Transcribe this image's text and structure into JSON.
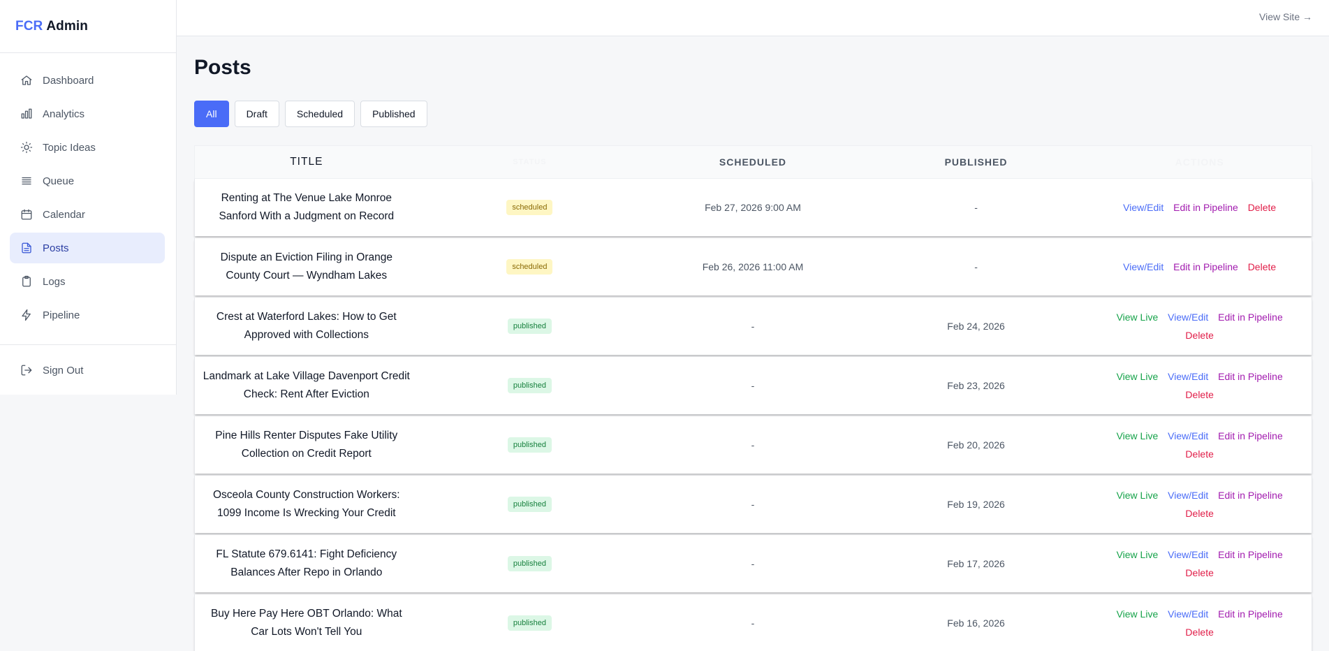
{
  "brand": {
    "accent": "FCR",
    "name": "Admin"
  },
  "sidebar": {
    "items": [
      {
        "label": "Dashboard",
        "icon": "home-icon"
      },
      {
        "label": "Analytics",
        "icon": "bar-chart-icon"
      },
      {
        "label": "Topic Ideas",
        "icon": "lightbulb-icon"
      },
      {
        "label": "Queue",
        "icon": "list-icon"
      },
      {
        "label": "Calendar",
        "icon": "calendar-icon"
      },
      {
        "label": "Posts",
        "icon": "document-icon",
        "active": true
      },
      {
        "label": "Logs",
        "icon": "clipboard-icon"
      },
      {
        "label": "Pipeline",
        "icon": "bolt-icon"
      }
    ],
    "sign_out": "Sign Out"
  },
  "topbar": {
    "view_site": "View Site →"
  },
  "page": {
    "title": "Posts"
  },
  "filters": [
    {
      "label": "All",
      "active": true
    },
    {
      "label": "Draft"
    },
    {
      "label": "Scheduled"
    },
    {
      "label": "Published"
    }
  ],
  "table": {
    "columns": [
      "Title",
      "Status",
      "Scheduled",
      "Published",
      "Actions"
    ],
    "rows": [
      {
        "title": "Renting at The Venue Lake Monroe Sanford With a Judgment on Record",
        "status": "scheduled",
        "scheduled": "Feb 27, 2026 9:00 AM",
        "published": "-",
        "actions": [
          "View/Edit",
          "Edit in Pipeline",
          "Delete"
        ]
      },
      {
        "title": "Dispute an Eviction Filing in Orange County Court — Wyndham Lakes",
        "status": "scheduled",
        "scheduled": "Feb 26, 2026 11:00 AM",
        "published": "-",
        "actions": [
          "View/Edit",
          "Edit in Pipeline",
          "Delete"
        ]
      },
      {
        "title": "Crest at Waterford Lakes: How to Get Approved with Collections",
        "status": "published",
        "scheduled": "-",
        "published": "Feb 24, 2026",
        "actions": [
          "View Live",
          "View/Edit",
          "Edit in Pipeline",
          "Delete"
        ]
      },
      {
        "title": "Landmark at Lake Village Davenport Credit Check: Rent After Eviction",
        "status": "published",
        "scheduled": "-",
        "published": "Feb 23, 2026",
        "actions": [
          "View Live",
          "View/Edit",
          "Edit in Pipeline",
          "Delete"
        ]
      },
      {
        "title": "Pine Hills Renter Disputes Fake Utility Collection on Credit Report",
        "status": "published",
        "scheduled": "-",
        "published": "Feb 20, 2026",
        "actions": [
          "View Live",
          "View/Edit",
          "Edit in Pipeline",
          "Delete"
        ]
      },
      {
        "title": "Osceola County Construction Workers: 1099 Income Is Wrecking Your Credit",
        "status": "published",
        "scheduled": "-",
        "published": "Feb 19, 2026",
        "actions": [
          "View Live",
          "View/Edit",
          "Edit in Pipeline",
          "Delete"
        ]
      },
      {
        "title": "FL Statute 679.6141: Fight Deficiency Balances After Repo in Orlando",
        "status": "published",
        "scheduled": "-",
        "published": "Feb 17, 2026",
        "actions": [
          "View Live",
          "View/Edit",
          "Edit in Pipeline",
          "Delete"
        ]
      },
      {
        "title": "Buy Here Pay Here OBT Orlando: What Car Lots Won't Tell You",
        "status": "published",
        "scheduled": "-",
        "published": "Feb 16, 2026",
        "actions": [
          "View Live",
          "View/Edit",
          "Edit in Pipeline",
          "Delete"
        ]
      }
    ]
  },
  "colors": {
    "accent": "#4a6cf7",
    "view_live": "#16a34a",
    "pipeline": "#a21caf",
    "delete": "#e11d48",
    "scheduled_badge_bg": "#fef6c3",
    "published_badge_bg": "#dcf7e6"
  }
}
